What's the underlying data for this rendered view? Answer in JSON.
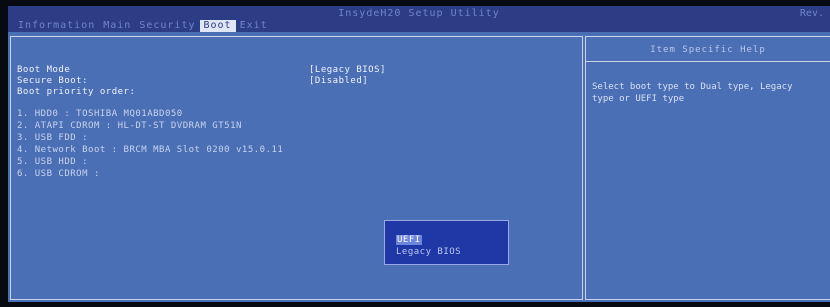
{
  "window": {
    "title": "InsydeH20 Setup Utility",
    "rev": "Rev."
  },
  "menu": [
    {
      "label": "Information"
    },
    {
      "label": "Main"
    },
    {
      "label": "Security"
    },
    {
      "label": "Boot"
    },
    {
      "label": "Exit"
    }
  ],
  "settings": {
    "boot_mode_label": "Boot Mode",
    "boot_mode_value": "[Legacy BIOS]",
    "secure_boot_label": "Secure Boot:",
    "secure_boot_value": "[Disabled]",
    "boot_order_label": "Boot priority order:"
  },
  "boot_order": [
    "1.  HDD0 : TOSHIBA MQ01ABD050",
    "2.  ATAPI CDROM : HL-DT-ST DVDRAM GT51N",
    "3.  USB FDD :",
    "4.  Network Boot : BRCM MBA Slot 0200 v15.0.11",
    "5.  USB HDD :",
    "6.  USB CDROM :"
  ],
  "help": {
    "title": "Item Specific Help",
    "line1": "Select boot type to Dual type, Legacy",
    "line2": "type or UEFI type"
  },
  "popup": {
    "options": [
      "UEFI",
      "Legacy BIOS"
    ],
    "selected_index": 0
  },
  "colors": {
    "background": "#4a6fb4",
    "titlebar": "#2c3d86",
    "popup": "#1f38a6",
    "text": "#f1f4fc"
  }
}
